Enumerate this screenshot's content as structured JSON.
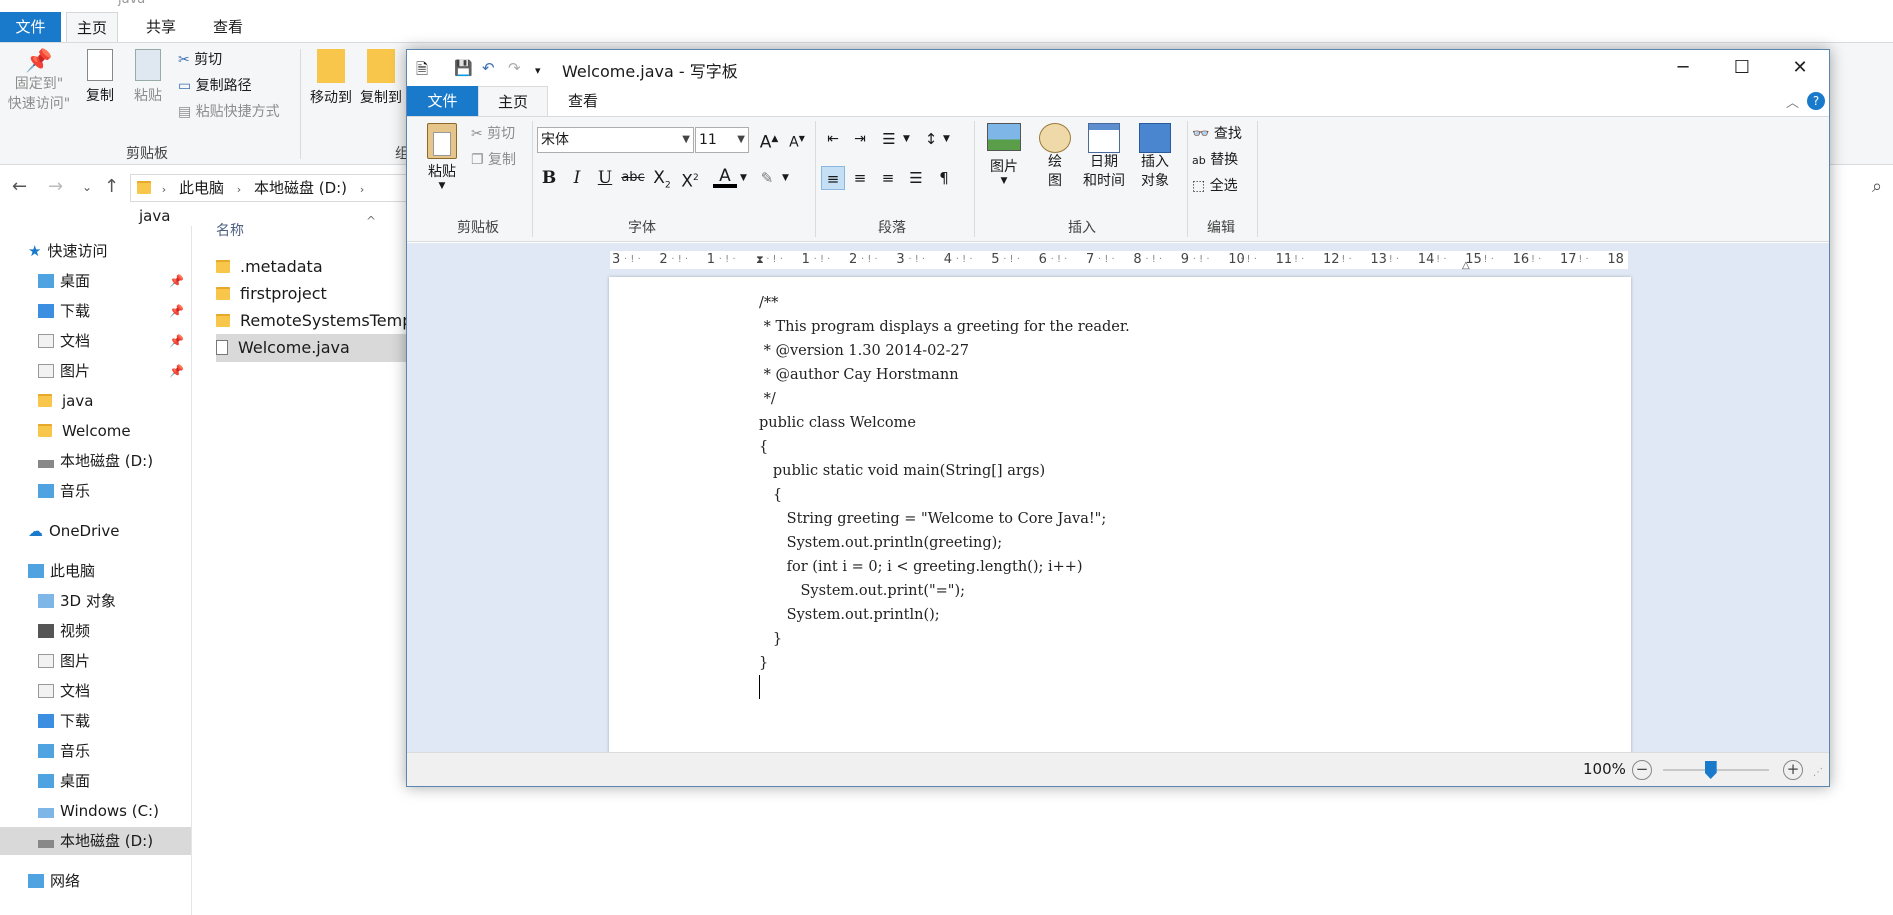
{
  "explorer": {
    "title_partial": "java",
    "tabs": [
      "文件",
      "主页",
      "共享",
      "查看"
    ],
    "ribbon": {
      "pin_label": "固定到\"\n快速访问\"",
      "copy_label": "复制",
      "paste_label": "粘贴",
      "cut_label": "剪切",
      "copy_path_label": "复制路径",
      "paste_shortcut_label": "粘贴快捷方式",
      "clipboard_group": "剪贴板",
      "move_to_label": "移动到",
      "copy_to_label": "复制到",
      "org_group_partial": "组"
    },
    "address": {
      "crumbs": [
        "此电脑",
        "本地磁盘 (D:)",
        "java"
      ]
    },
    "column_header": "名称",
    "files": [
      ".metadata",
      "firstproject",
      "RemoteSystemsTempl",
      "Welcome.java"
    ],
    "nav": {
      "quick_access": "快速访问",
      "quick_items": [
        "桌面",
        "下载",
        "文档",
        "图片",
        "java",
        "Welcome",
        "本地磁盘 (D:)",
        "音乐"
      ],
      "onedrive": "OneDrive",
      "this_pc": "此电脑",
      "pc_items": [
        "3D 对象",
        "视频",
        "图片",
        "文档",
        "下载",
        "音乐",
        "桌面",
        "Windows (C:)",
        "本地磁盘 (D:)"
      ],
      "network": "网络"
    }
  },
  "wordpad": {
    "title": "Welcome.java - 写字板",
    "tabs": {
      "file": "文件",
      "home": "主页",
      "view": "查看"
    },
    "clipboard": {
      "paste": "粘贴",
      "cut": "剪切",
      "copy": "复制",
      "group": "剪贴板"
    },
    "font": {
      "family": "宋体",
      "size": "11",
      "group": "字体"
    },
    "paragraph": {
      "group": "段落"
    },
    "insert": {
      "picture": "图片",
      "paint1": "绘",
      "paint2": "图",
      "datetime1": "日期",
      "datetime2": "和时间",
      "object1": "插入",
      "object2": "对象",
      "group": "插入"
    },
    "editing": {
      "find": "查找",
      "replace": "替换",
      "select_all": "全选",
      "group": "编辑"
    },
    "ruler_ticks": [
      "3",
      "2",
      "1",
      "",
      "1",
      "2",
      "3",
      "4",
      "5",
      "6",
      "7",
      "8",
      "9",
      "10",
      "11",
      "12",
      "13",
      "14",
      "15",
      "16",
      "17",
      "18"
    ],
    "document_text": "/**\n * This program displays a greeting for the reader.\n * @version 1.30 2014-02-27\n * @author Cay Horstmann\n */\npublic class Welcome\n{\n   public static void main(String[] args)\n   {\n      String greeting = \"Welcome to Core Java!\";\n      System.out.println(greeting);\n      for (int i = 0; i < greeting.length(); i++)\n         System.out.print(\"=\");\n      System.out.println();\n   }\n}",
    "zoom": "100%",
    "zoom_level_fraction": 0.45
  },
  "colors": {
    "accent": "#1979ca",
    "doc_bg": "#dfe8f4"
  }
}
